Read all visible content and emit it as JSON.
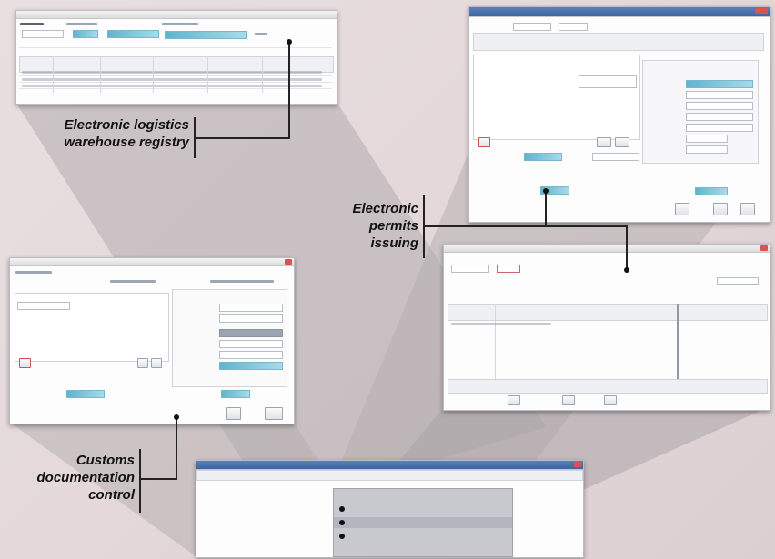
{
  "callouts": {
    "logistics": [
      "Electronic logistics",
      "warehouse registry"
    ],
    "permits": [
      "Electronic",
      "permits",
      "issuing"
    ],
    "customs": [
      "Customs",
      "documentation",
      "control"
    ]
  },
  "colors": {
    "background": "#e6dadc",
    "beam": "#a9a3a5",
    "field_accent": "#6fbfd6",
    "titlebar_blue": "#4a6fa8",
    "connector": "#222222"
  },
  "icons": [
    "close-icon",
    "menu-arrow-icon",
    "radio-dot-icon",
    "print-icon",
    "save-icon",
    "delete-icon"
  ]
}
